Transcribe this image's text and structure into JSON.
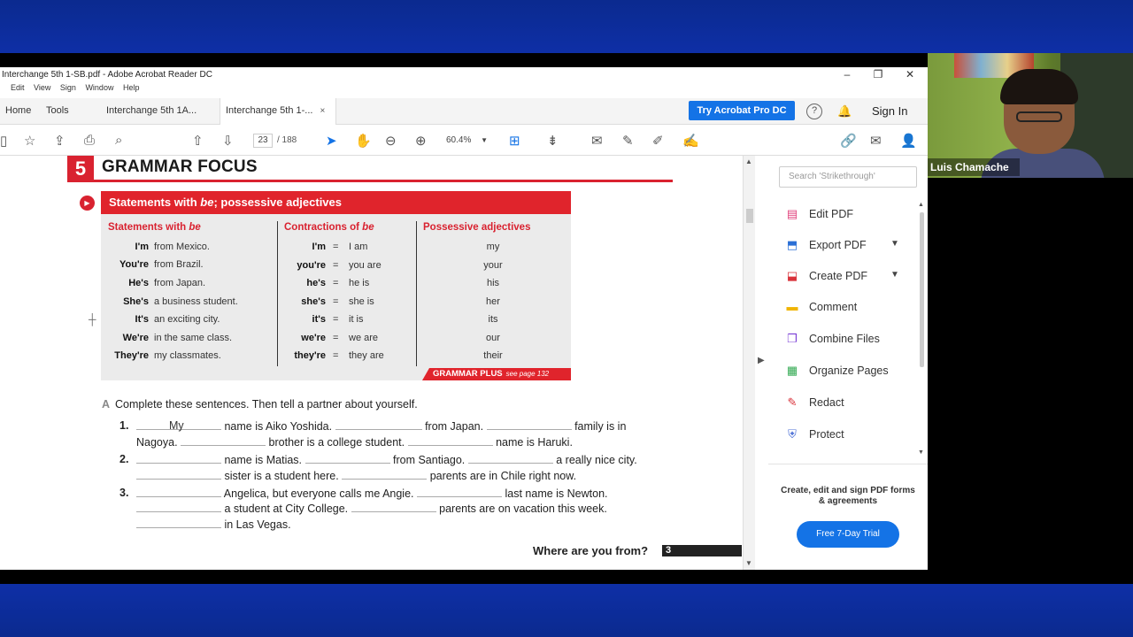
{
  "window": {
    "title": "Interchange 5th 1-SB.pdf - Adobe Acrobat Reader DC",
    "menu": [
      "Edit",
      "View",
      "Sign",
      "Window",
      "Help"
    ]
  },
  "tabs": {
    "home": "Home",
    "tools": "Tools",
    "doc1": "Interchange 5th 1A...",
    "doc2": "Interchange 5th 1-...",
    "close": "×"
  },
  "topbar": {
    "try_pro": "Try Acrobat Pro DC",
    "help": "?",
    "sign_in": "Sign In"
  },
  "toolbar": {
    "page_current": "23",
    "page_total": "/ 188",
    "zoom": "60.4%"
  },
  "page": {
    "section_number": "5",
    "section_title": "GRAMMAR FOCUS",
    "box_title_pre": "Statements with ",
    "box_title_em": "be",
    "box_title_post": "; possessive adjectives",
    "col1_head_pre": "Statements with ",
    "col1_head_em": "be",
    "col2_head_pre": "Contractions of ",
    "col2_head_em": "be",
    "col3_head": "Possessive adjectives",
    "statements": [
      {
        "pron": "I'm",
        "rest": "from Mexico."
      },
      {
        "pron": "You're",
        "rest": "from Brazil."
      },
      {
        "pron": "He's",
        "rest": "from Japan."
      },
      {
        "pron": "She's",
        "rest": "a business student."
      },
      {
        "pron": "It's",
        "rest": "an exciting city."
      },
      {
        "pron": "We're",
        "rest": "in the same class."
      },
      {
        "pron": "They're",
        "rest": "my classmates."
      }
    ],
    "contractions": [
      {
        "short": "I'm",
        "eq": "=",
        "full": "I am"
      },
      {
        "short": "you're",
        "eq": "=",
        "full": "you are"
      },
      {
        "short": "he's",
        "eq": "=",
        "full": "he is"
      },
      {
        "short": "she's",
        "eq": "=",
        "full": "she is"
      },
      {
        "short": "it's",
        "eq": "=",
        "full": "it is"
      },
      {
        "short": "we're",
        "eq": "=",
        "full": "we are"
      },
      {
        "short": "they're",
        "eq": "=",
        "full": "they are"
      }
    ],
    "possessives": [
      "my",
      "your",
      "his",
      "her",
      "its",
      "our",
      "their"
    ],
    "grammar_plus": "GRAMMAR PLUS",
    "grammar_plus_page": "see page 132",
    "exercise_letter": "A",
    "exercise_instruction": "Complete these sentences. Then tell a partner about yourself.",
    "item1_num": "1.",
    "item1_fill": "My",
    "item1_l1a": "name is Aiko Yoshida.",
    "item1_l1b": "from Japan.",
    "item1_l1c": "family is in",
    "item1_l2a": "Nagoya.",
    "item1_l2b": "brother is a college student.",
    "item1_l2c": "name is Haruki.",
    "item2_num": "2.",
    "item2_l1a": "name is Matias.",
    "item2_l1b": "from Santiago.",
    "item2_l1c": "a really nice city.",
    "item2_l2a": "sister is a student here.",
    "item2_l2b": "parents are in Chile right now.",
    "item3_num": "3.",
    "item3_l1a": "Angelica, but everyone calls me Angie.",
    "item3_l1b": "last name is Newton.",
    "item3_l2a": "a student at City College.",
    "item3_l2b": "parents are on vacation this week.",
    "item3_l3a": "in Las Vegas.",
    "footer_title": "Where are you from?",
    "footer_page": "3"
  },
  "right_pane": {
    "search_placeholder": "Search 'Strikethrough'",
    "tools": [
      {
        "label": "Edit PDF",
        "icon": "edit-pdf-icon",
        "color": "#e0407b"
      },
      {
        "label": "Export PDF",
        "icon": "export-pdf-icon",
        "color": "#2a6fd6"
      },
      {
        "label": "Create PDF",
        "icon": "create-pdf-icon",
        "color": "#d9323a"
      },
      {
        "label": "Comment",
        "icon": "comment-icon",
        "color": "#f0b400"
      },
      {
        "label": "Combine Files",
        "icon": "combine-files-icon",
        "color": "#7b3fd6"
      },
      {
        "label": "Organize Pages",
        "icon": "organize-pages-icon",
        "color": "#2fa84f"
      },
      {
        "label": "Redact",
        "icon": "redact-icon",
        "color": "#d9323a"
      },
      {
        "label": "Protect",
        "icon": "protect-icon",
        "color": "#4b6fd6"
      }
    ],
    "promo_text": "Create, edit and sign PDF forms & agreements",
    "trial_button": "Free 7-Day Trial"
  },
  "webcam": {
    "participant_name": "Luis Chamache"
  },
  "colors": {
    "accent_red": "#e0242c",
    "acrobat_blue": "#1473e6",
    "background_blue": "#0d2a9e"
  }
}
